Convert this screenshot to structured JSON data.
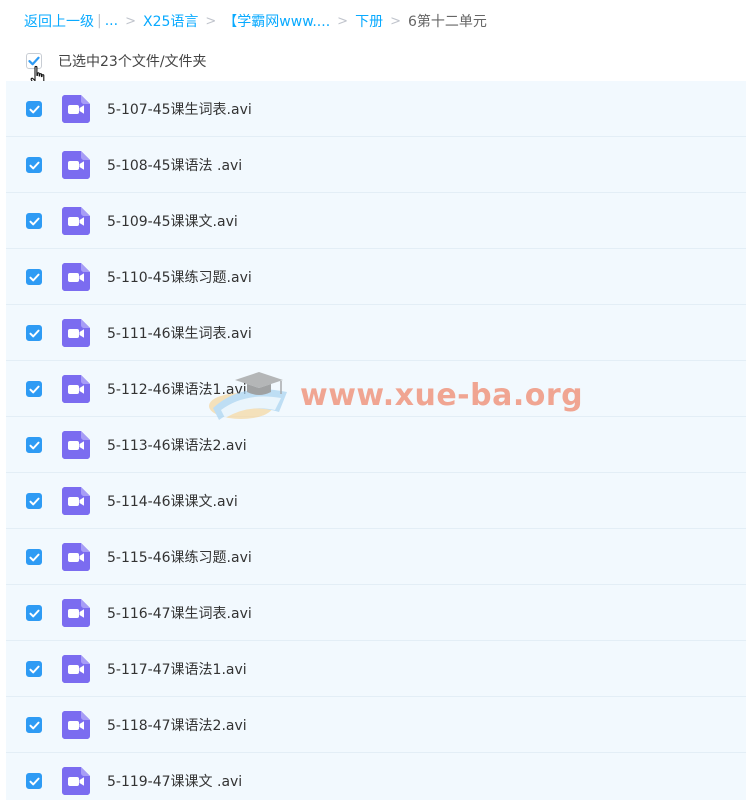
{
  "breadcrumb": {
    "back": "返回上一级",
    "pipe": "|",
    "ellipsis": "...",
    "sep": ">",
    "crumbs": [
      "X25语言",
      "【学霸网www....",
      "下册"
    ],
    "current": "6第十二单元"
  },
  "selection": {
    "label": "已选中23个文件/文件夹"
  },
  "files": [
    {
      "name": "5-107-45课生词表.avi"
    },
    {
      "name": "5-108-45课语法 .avi"
    },
    {
      "name": "5-109-45课课文.avi"
    },
    {
      "name": "5-110-45课练习题.avi"
    },
    {
      "name": "5-111-46课生词表.avi"
    },
    {
      "name": "5-112-46课语法1.avi"
    },
    {
      "name": "5-113-46课语法2.avi"
    },
    {
      "name": "5-114-46课课文.avi"
    },
    {
      "name": "5-115-46课练习题.avi"
    },
    {
      "name": "5-116-47课生词表.avi"
    },
    {
      "name": "5-117-47课语法1.avi"
    },
    {
      "name": "5-118-47课语法2.avi"
    },
    {
      "name": "5-119-47课课文 .avi"
    }
  ],
  "watermark": {
    "text": "www.xue-ba.org"
  },
  "icons": {
    "file": "video-file-icon",
    "check": "checkmark-icon",
    "cursor": "hand-pointer-icon"
  },
  "colors": {
    "link": "#09aaff",
    "checkbox": "#2e9bf4",
    "video_icon": "#7b6cf0",
    "list_bg": "#f2f9fe",
    "watermark": "#f08a6e"
  }
}
